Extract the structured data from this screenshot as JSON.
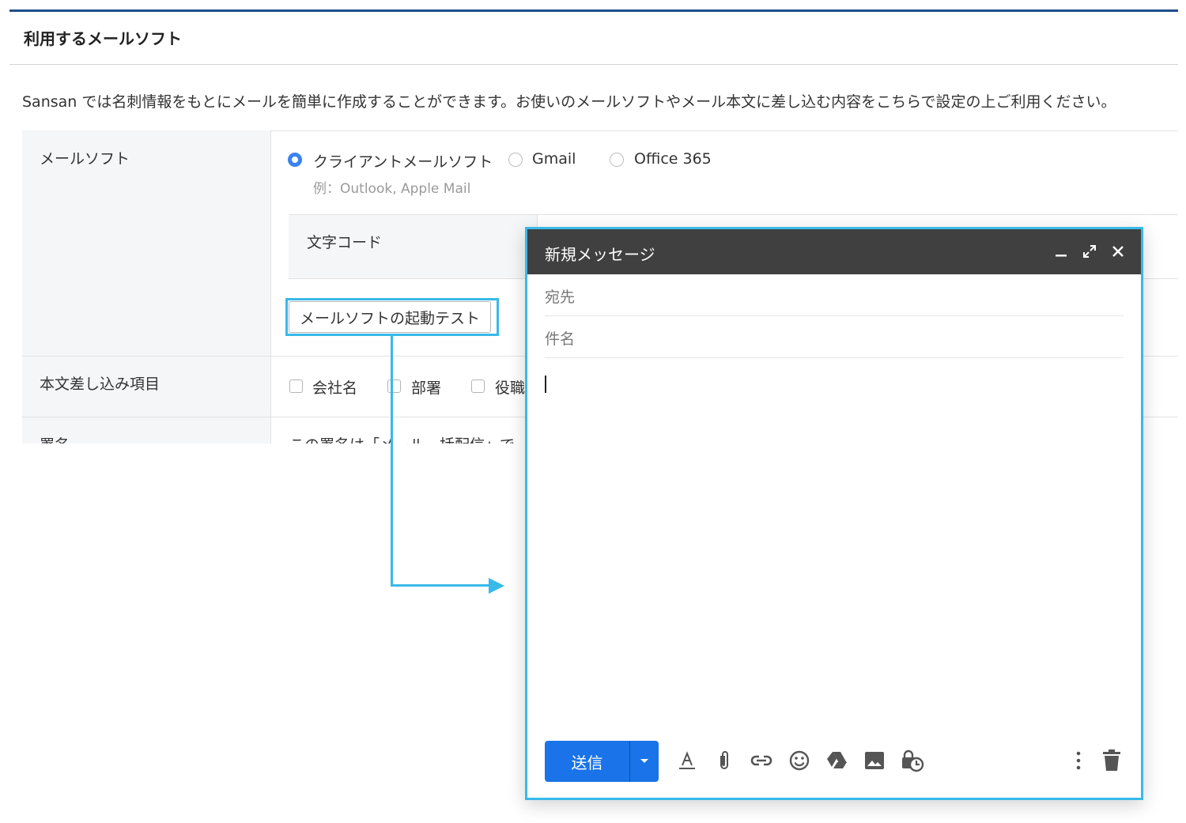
{
  "section": {
    "title": "利用するメールソフト"
  },
  "description": "Sansan では名刺情報をもとにメールを簡単に作成することができます。お使いのメールソフトやメール本文に差し込む内容をこちらで設定の上ご利用ください。",
  "mail_software": {
    "label": "メールソフト",
    "options": [
      {
        "label": "クライアントメールソフト",
        "selected": true
      },
      {
        "label": "Gmail",
        "selected": false
      },
      {
        "label": "Office 365",
        "selected": false
      }
    ],
    "hint": "例：Outlook, Apple Mail",
    "charset_label": "文字コード",
    "test_button": "メールソフトの起動テスト"
  },
  "insert_fields": {
    "label": "本文差し込み項目",
    "options": [
      "会社名",
      "部署",
      "役職"
    ]
  },
  "signature": {
    "label": "署名",
    "text": "この署名は「メール一括配信」で"
  },
  "compose": {
    "title": "新規メッセージ",
    "to_placeholder": "宛先",
    "subject_placeholder": "件名",
    "send_label": "送信"
  },
  "colors": {
    "accent": "#39b9e8",
    "header_line": "#1f4e8c",
    "send_button": "#1a73e8",
    "compose_header": "#404040"
  }
}
